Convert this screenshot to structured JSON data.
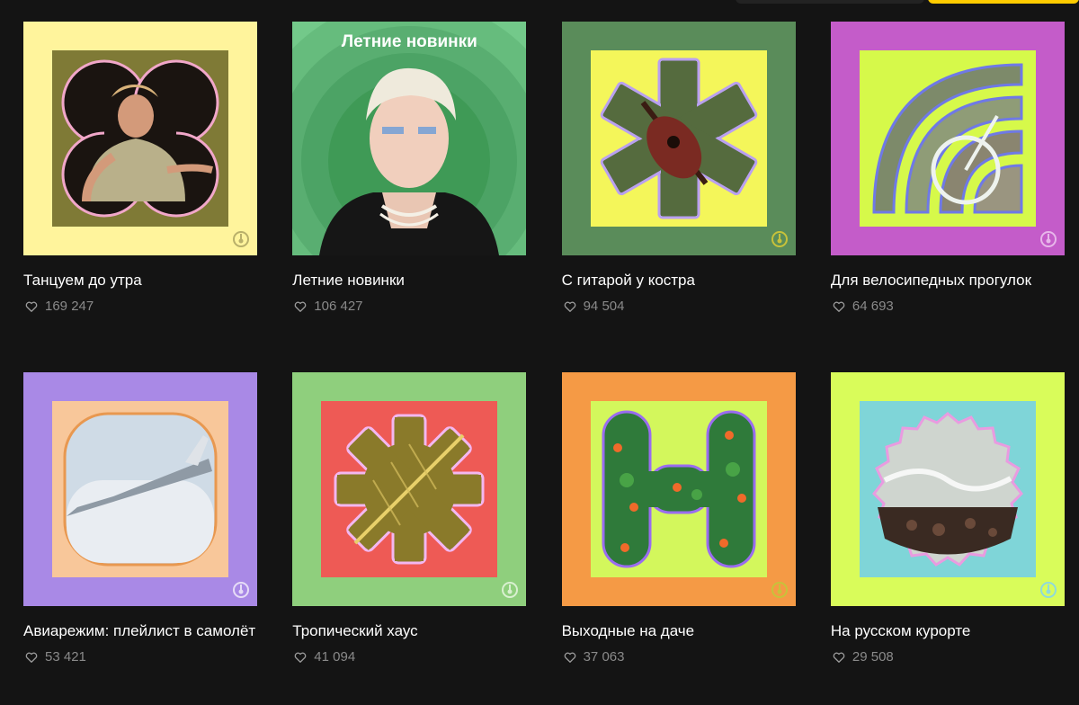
{
  "playlists": [
    {
      "title": "Танцуем до утра",
      "likes": "169 247",
      "outer": "#fff49c",
      "inner": "#7f7a36",
      "cover_label": ""
    },
    {
      "title": "Летние новинки",
      "likes": "106 427",
      "outer": "#73c98a",
      "inner": "#3f9a56",
      "cover_label": "Летние новинки"
    },
    {
      "title": "С гитарой у костра",
      "likes": "94 504",
      "outer": "#5a8c5a",
      "inner": "#f4f65a",
      "cover_label": ""
    },
    {
      "title": "Для велосипедных прогулок",
      "likes": "64 693",
      "outer": "#c45cc9",
      "inner": "#d6f94a",
      "cover_label": ""
    },
    {
      "title": "Авиарежим: плейлист в самолёт",
      "likes": "53 421",
      "outer": "#a989e6",
      "inner": "#f8c79a",
      "cover_label": ""
    },
    {
      "title": "Тропический хаус",
      "likes": "41 094",
      "outer": "#8fcf7d",
      "inner": "#ee5a55",
      "cover_label": ""
    },
    {
      "title": "Выходные на даче",
      "likes": "37 063",
      "outer": "#f59a45",
      "inner": "#d3f75c",
      "cover_label": ""
    },
    {
      "title": "На русском курорте",
      "likes": "29 508",
      "outer": "#d9fc5a",
      "inner": "#7fd5d8",
      "cover_label": ""
    }
  ],
  "icons": {
    "like": "heart-icon",
    "brand": "yandex-music-icon"
  },
  "colors": {
    "background": "#141414",
    "accent": "#ffcc00",
    "muted": "#8a8a8a"
  }
}
